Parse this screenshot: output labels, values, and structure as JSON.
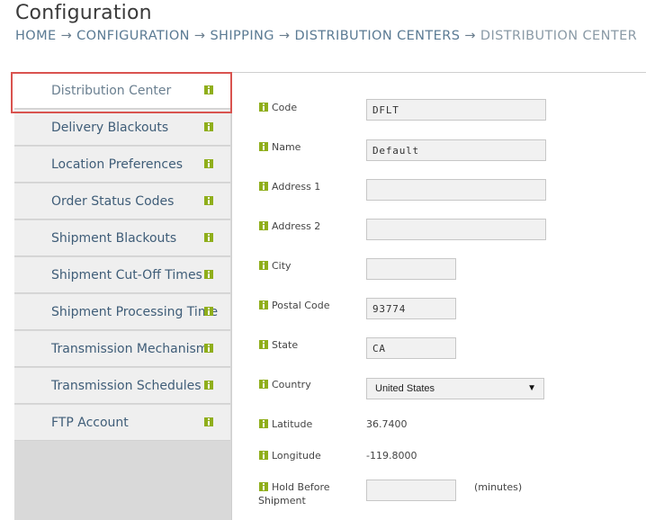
{
  "page": {
    "title": "Configuration"
  },
  "breadcrumb": {
    "home": "HOME",
    "configuration": "CONFIGURATION",
    "shipping": "SHIPPING",
    "distribution_centers": "DISTRIBUTION CENTERS",
    "current": "DISTRIBUTION CENTER",
    "separator": "→"
  },
  "sidebar": {
    "items": [
      {
        "label": "Distribution Center",
        "active": true
      },
      {
        "label": "Delivery Blackouts"
      },
      {
        "label": "Location Preferences"
      },
      {
        "label": "Order Status Codes"
      },
      {
        "label": "Shipment Blackouts"
      },
      {
        "label": "Shipment Cut-Off Times"
      },
      {
        "label": "Shipment Processing Time"
      },
      {
        "label": "Transmission Mechanism"
      },
      {
        "label": "Transmission Schedules"
      },
      {
        "label": "FTP Account"
      }
    ],
    "icon": "help-icon",
    "highlight_color": "#d9534f"
  },
  "form": {
    "code": {
      "label": "Code",
      "value": "DFLT"
    },
    "name": {
      "label": "Name",
      "value": "Default"
    },
    "address1": {
      "label": "Address 1",
      "value": ""
    },
    "address2": {
      "label": "Address 2",
      "value": ""
    },
    "city": {
      "label": "City",
      "value": ""
    },
    "postal_code": {
      "label": "Postal Code",
      "value": "93774"
    },
    "state": {
      "label": "State",
      "value": "CA"
    },
    "country": {
      "label": "Country",
      "value": "United States"
    },
    "latitude": {
      "label": "Latitude",
      "value": "36.7400"
    },
    "longitude": {
      "label": "Longitude",
      "value": "-119.8000"
    },
    "hold_before_shipment": {
      "label_line1": "Hold Before",
      "label_line2": "Shipment",
      "value": "",
      "unit": "(minutes)"
    }
  },
  "colors": {
    "help_icon": "#8fae1b",
    "link": "#3f5d78"
  }
}
